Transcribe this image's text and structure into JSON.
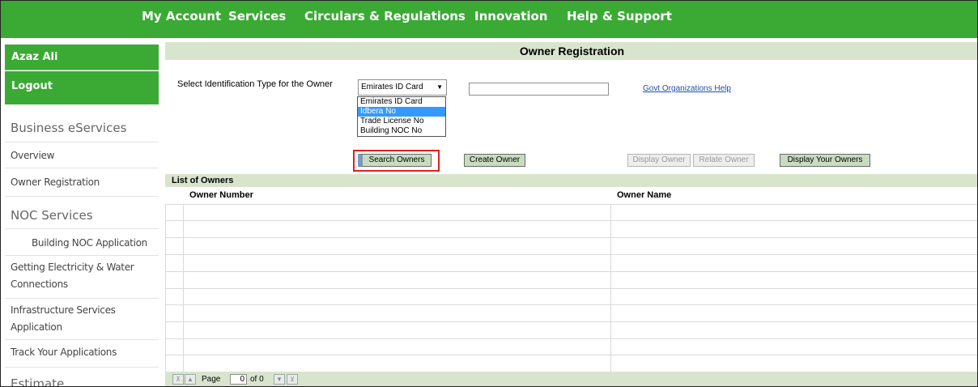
{
  "nav": {
    "items": [
      "My Account",
      "Services",
      "Circulars & Regulations",
      "Innovation",
      "Help & Support"
    ]
  },
  "sidebar": {
    "user_name": "Azaz Ali",
    "logout": "Logout",
    "section_business": "Business eServices",
    "overview": "Overview",
    "owner_registration": "Owner Registration",
    "section_noc": "NOC Services",
    "building_noc": "Building NOC Application",
    "electricity_line1": "Getting Electricity & Water",
    "electricity_line2": "Connections",
    "infra_line1": "Infrastructure Services",
    "infra_line2": "Application",
    "track": "Track Your Applications",
    "section_estimate": "Estimate"
  },
  "main": {
    "title": "Owner Registration",
    "id_type_label": "Select Identification Type for the Owner",
    "id_type_selected": "Emirates ID Card",
    "id_type_options": [
      "Emirates ID Card",
      "Idbera No",
      "Trade License No",
      "Building NOC No"
    ],
    "id_type_highlighted": "Idbera No",
    "id_input_value": "",
    "help_link": "Govt Organizations Help",
    "buttons": {
      "search": "Search Owners",
      "create": "Create Owner",
      "display": "Display Owner",
      "relate": "Relate Owner",
      "display_yours": "Display Your Owners"
    },
    "list_title": "List of Owners",
    "columns": [
      "Owner Number",
      "Owner Name"
    ],
    "rows": [],
    "pager": {
      "page_label": "Page",
      "page_value": "0",
      "of_label": "of 0"
    }
  },
  "colors": {
    "brand_green": "#3aaa35",
    "panel_green": "#d9e4cd",
    "highlight_red": "#e02020",
    "selected_blue": "#3399ff"
  }
}
